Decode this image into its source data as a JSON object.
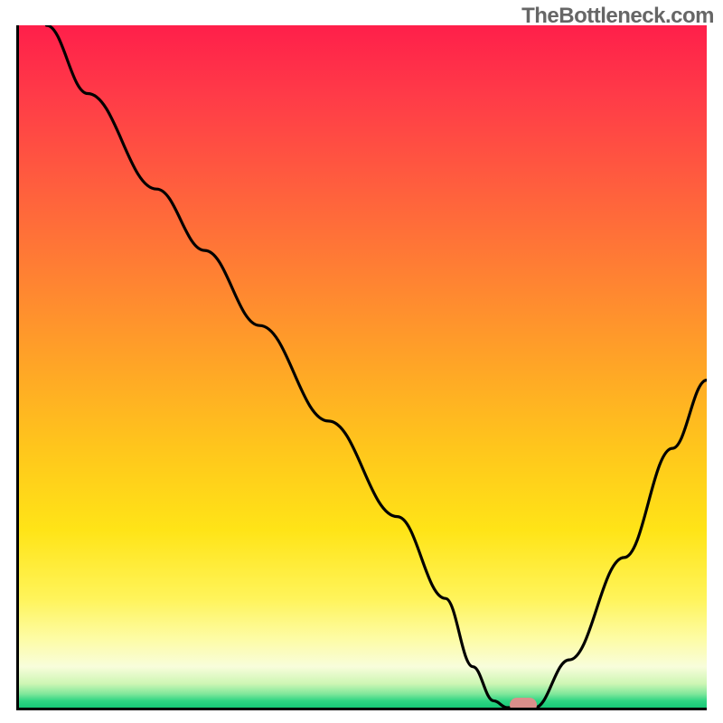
{
  "watermark": "TheBottleneck.com",
  "colors": {
    "gradient_top": "#ff1f4a",
    "gradient_mid": "#ffc61c",
    "gradient_bottom": "#16c977",
    "curve": "#000000",
    "marker": "#db8f8b",
    "axis": "#000000"
  },
  "chart_data": {
    "type": "line",
    "title": "",
    "xlabel": "",
    "ylabel": "",
    "xlim": [
      0,
      100
    ],
    "ylim": [
      0,
      100
    ],
    "grid": false,
    "legend": false,
    "series": [
      {
        "name": "bottleneck-curve",
        "x": [
          4,
          10,
          20,
          27,
          35,
          45,
          55,
          62,
          66,
          69,
          71,
          75,
          80,
          88,
          95,
          100
        ],
        "y": [
          100,
          90,
          76,
          67,
          56,
          42,
          28,
          16,
          6,
          1,
          0,
          0,
          7,
          22,
          38,
          48
        ]
      }
    ],
    "marker": {
      "x": 73,
      "y": 0.5
    },
    "background": "rainbow-gradient-red-to-green"
  }
}
